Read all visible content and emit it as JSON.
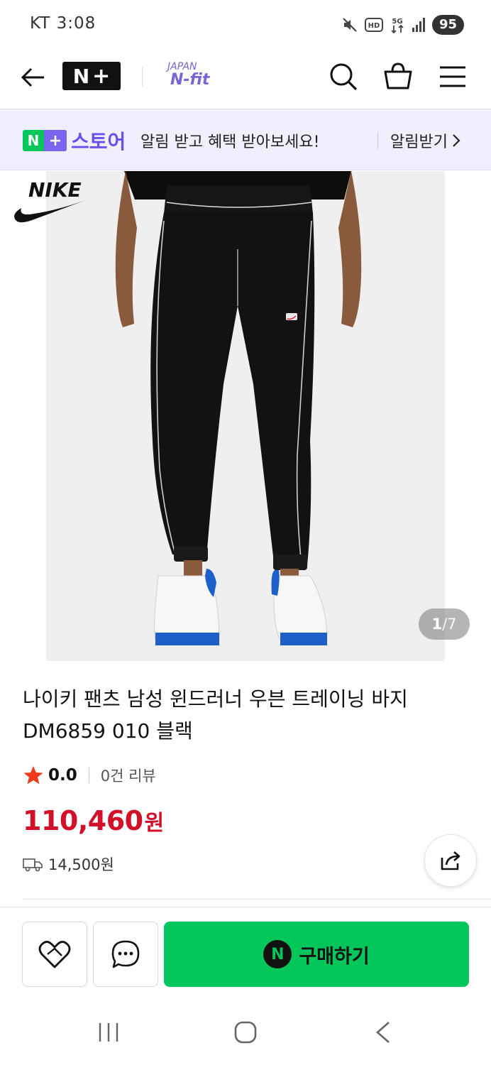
{
  "status_bar": {
    "carrier_time": "KT 3:08",
    "battery": "95",
    "icons": [
      "mute-icon",
      "hd-icon",
      "5g-icon",
      "signal-icon"
    ]
  },
  "header": {
    "logo_n": "N",
    "logo_plus": "+",
    "brand_top": "JAPAN",
    "brand_bottom": "N-fit",
    "icons": [
      "back-arrow-icon",
      "search-icon",
      "cart-icon",
      "menu-icon"
    ]
  },
  "banner": {
    "logo_n": "N",
    "logo_plus": "+",
    "store": "스토어",
    "message": "알림 받고 혜택 받아보세요!",
    "action": "알림받기"
  },
  "gallery": {
    "current": "1",
    "separator": "/",
    "total": "7"
  },
  "product": {
    "title": "나이키 팬츠 남성 윈드러너 우븐 트레이닝 바지 DM6859 010 블랙",
    "rating": "0.0",
    "reviews": "0건 리뷰",
    "price": "110,460",
    "price_unit": "원",
    "shipping": "14,500원"
  },
  "actions": {
    "buy_badge": "N",
    "buy_label": "구매하기"
  },
  "colors": {
    "naver_green": "#03c75a",
    "price_red": "#d1112a",
    "plus_purple": "#6a4ff0",
    "banner_bg": "#f1efff"
  }
}
